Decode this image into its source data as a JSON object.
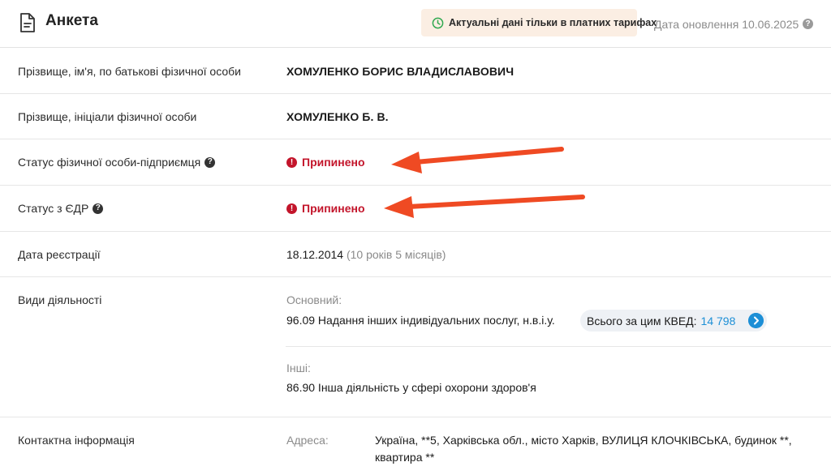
{
  "header": {
    "title": "Анкета",
    "promo_text": "Актуальні дані тільки в платних тарифах",
    "update_text": "Дата оновлення 10.06.2025",
    "help_glyph": "?"
  },
  "rows": {
    "full_name": {
      "label": "Прізвище, ім'я, по батькові фізичної особи",
      "value": "ХОМУЛЕНКО БОРИС ВЛАДИСЛАВОВИЧ"
    },
    "initials": {
      "label": "Прізвище, ініціали фізичної особи",
      "value": "ХОМУЛЕНКО Б. В."
    },
    "fop_status": {
      "label": "Статус фізичної особи-підприємця",
      "value": "Припинено"
    },
    "edr_status": {
      "label": "Статус з ЄДР",
      "value": "Припинено"
    },
    "registration": {
      "label": "Дата реєстрації",
      "date": "18.12.2014",
      "age": "(10 років 5 місяців)"
    },
    "activities": {
      "label": "Види діяльності",
      "main_label": "Основний:",
      "main_value": "96.09 Надання інших індивідуальних послуг, н.в.і.у.",
      "kved_label": "Всього за цим КВЕД:",
      "kved_count": "14 798",
      "other_label": "Інші:",
      "other_value": "86.90 Інша діяльність у сфері охорони здоров'я"
    },
    "contacts": {
      "label": "Контактна інформація",
      "address_label": "Адреса:",
      "address_value": "Україна, **5, Харківська обл., місто Харків, ВУЛИЦЯ КЛОЧКІВСЬКА, будинок **, квартира **"
    }
  },
  "icons": {
    "header": "document-icon",
    "promo": "clock-icon",
    "help": "question-circle-icon",
    "status": "exclamation-circle-icon",
    "kved": "chevron-right-circle-icon",
    "annotation": "red-arrow"
  },
  "colors": {
    "status_red": "#c3152b",
    "link_blue": "#1d8fd6",
    "promo_bg": "#fbeee3",
    "clock_green": "#2fa84f",
    "annotation_arrow": "#ef4a23"
  }
}
